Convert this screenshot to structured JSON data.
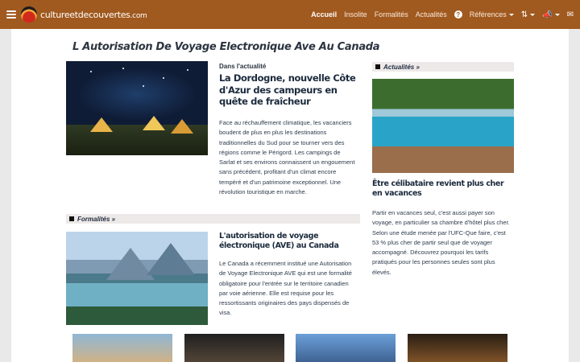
{
  "navbar": {
    "brand": "cultureetdecouvertes",
    "brand_domain": ".com",
    "links": [
      {
        "label": "Accueil",
        "active": true
      },
      {
        "label": "Insolite"
      },
      {
        "label": "Formalités"
      },
      {
        "label": "Actualités"
      }
    ],
    "references_label": "Références",
    "icons": [
      "menu-icon",
      "help-icon",
      "sort-icon",
      "megaphone-icon",
      "mail-icon"
    ],
    "bg_color": "#a0591f"
  },
  "page": {
    "title": "L Autorisation De Voyage Electronique Ave Au Canada"
  },
  "main_article": {
    "kicker": "Dans l'actualité",
    "headline": "La Dordogne, nouvelle Côte d'Azur des campeurs en quête de fraîcheur",
    "excerpt": "Face au réchauffement climatique, les vacanciers boudent de plus en plus les destinations traditionnelles du Sud pour se tourner vers des régions comme le Périgord. Les campings de Sarlat et ses environs connaissent un engouement sans précédent, profitant d'un climat encore tempéré et d'un patrimoine exceptionnel. Une révolution touristique en marche."
  },
  "formalites": {
    "section_label": "Formalités »",
    "headline": "L'autorisation de voyage électronique (AVE) au Canada",
    "excerpt": "Le Canada a récemment institué une Autorisation de Voyage Electronique AVE qui est une formalité obligatoire pour l'entrée sur le territoire canadien par voie aérienne. Elle est requise pour les ressortissants originaires des pays dispensés de visa."
  },
  "sidebar": {
    "section_label": "Actualités »",
    "headline": "Être célibataire revient plus cher en vacances",
    "excerpt": "Partir en vacances seul, c'est aussi payer son voyage, en particulier sa chambre d'hôtel plus cher. Selon une étude menée par l'UFC-Que faire, c'est 53 % plus cher de partir seul que de voyager accompagné. Découvrez pourquoi les tarifs pratiqués pour les personnes seules sont plus élevés."
  }
}
